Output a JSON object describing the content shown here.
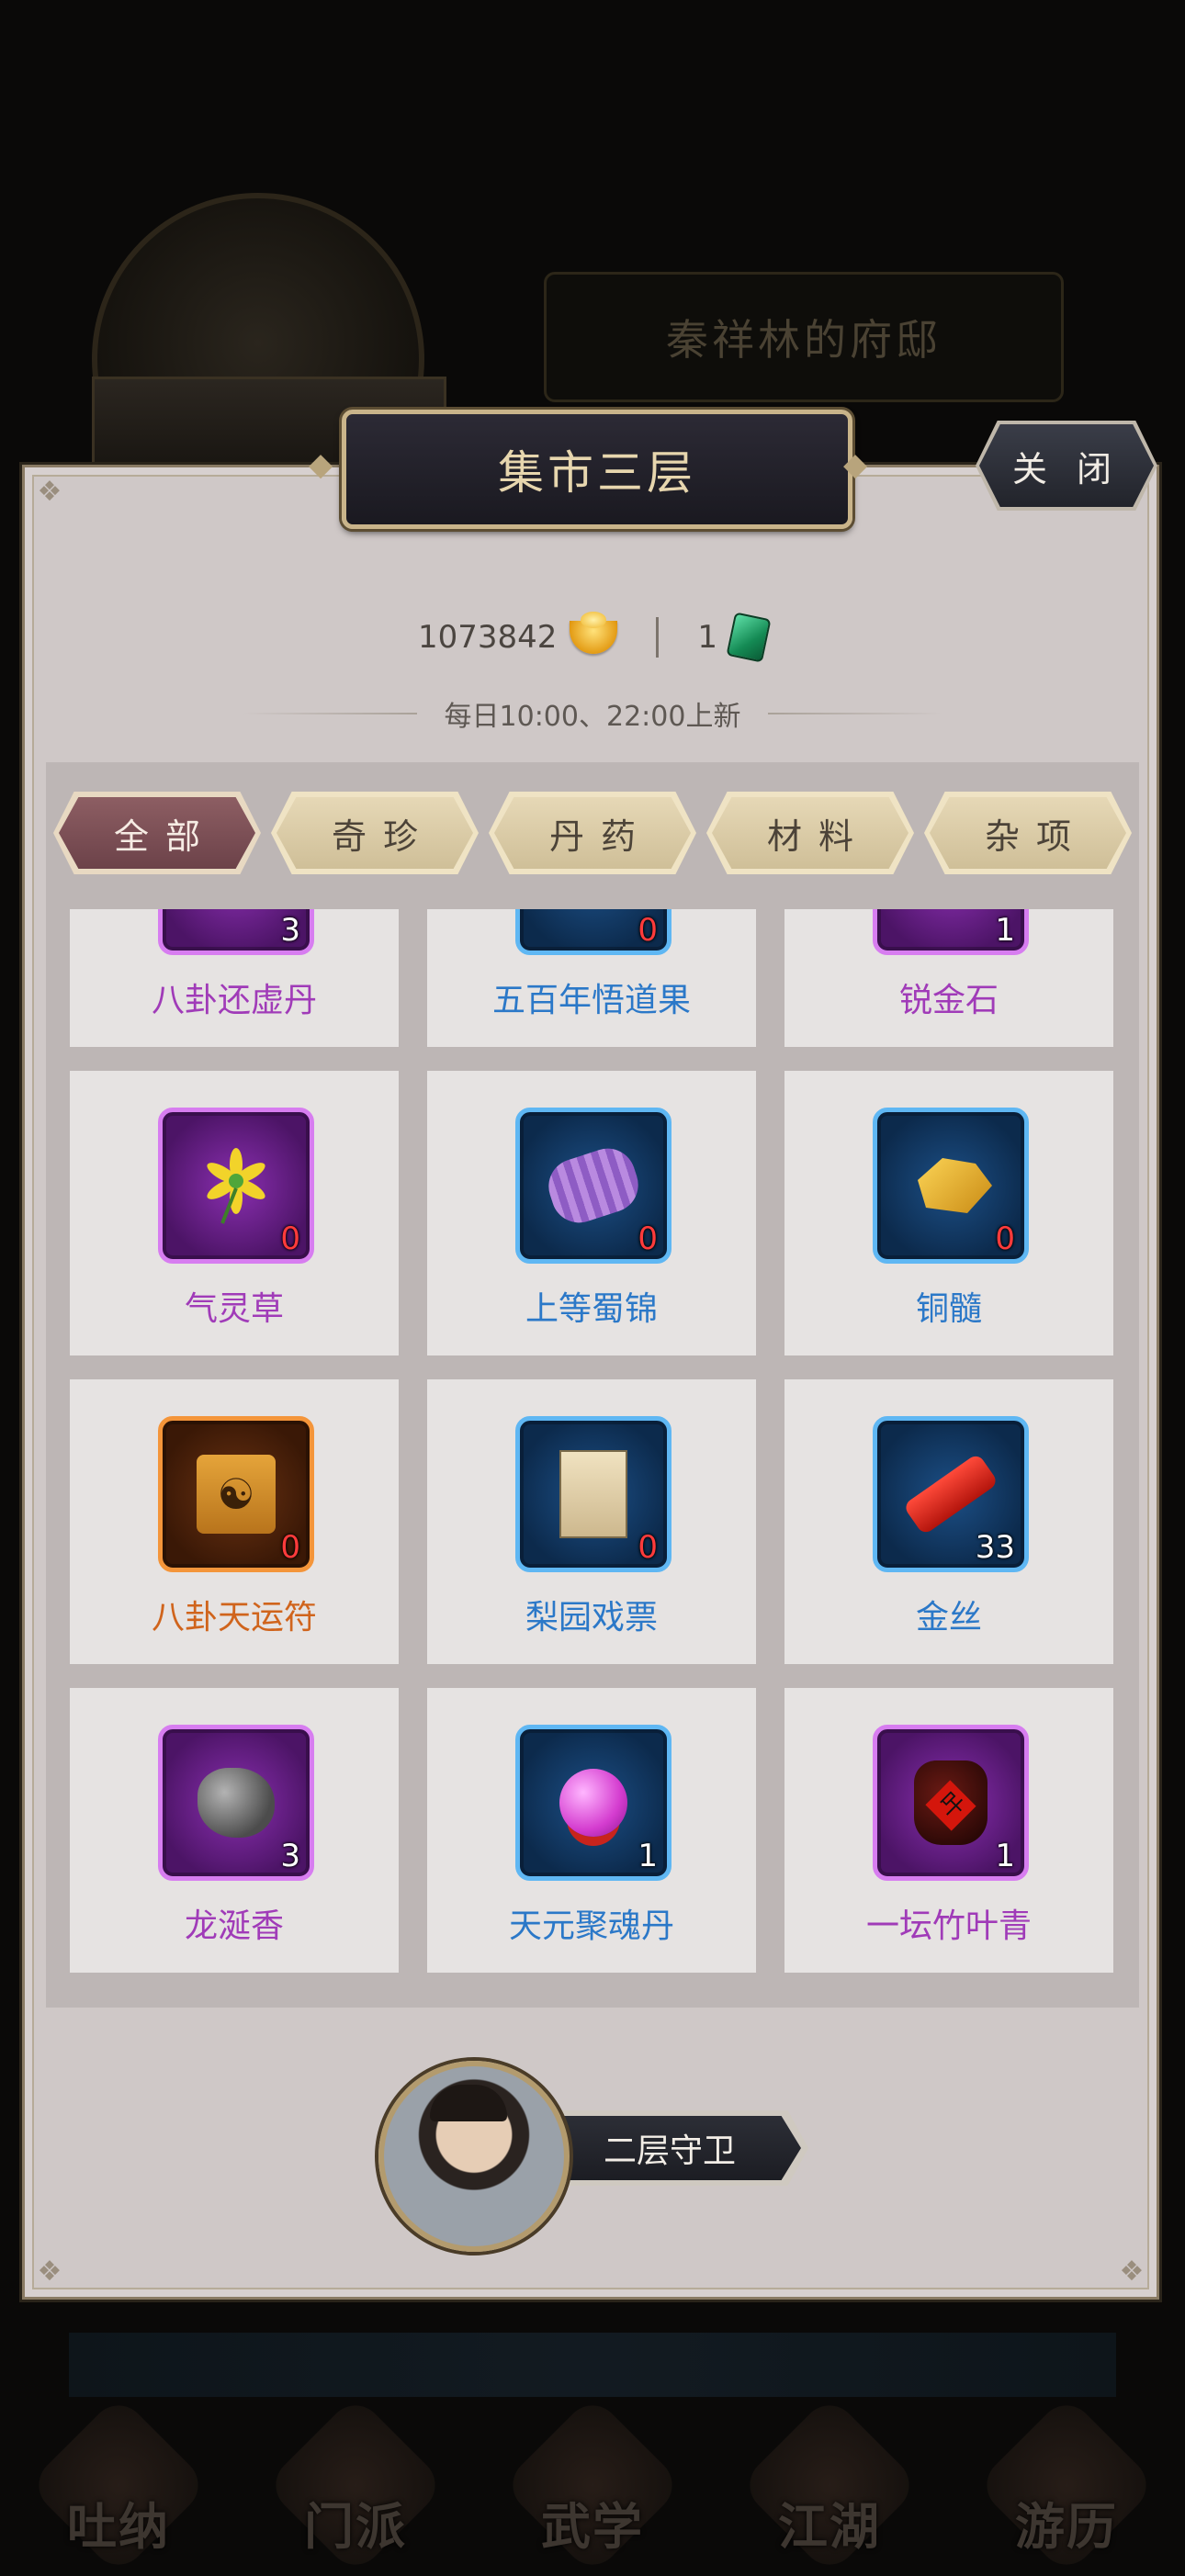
{
  "background": {
    "mansion_label": "秦祥林的府邸",
    "bottom_nav": [
      "吐纳",
      "门派",
      "武学",
      "江湖",
      "游历"
    ]
  },
  "modal": {
    "title": "集市三层",
    "close_label": "关 闭",
    "currency": {
      "gold": "1073842",
      "jade": "1",
      "gold_icon": "gold-ingot-icon",
      "jade_icon": "jade-token-icon"
    },
    "refresh_note": "每日10:00、22:00上新",
    "tabs": [
      {
        "label": "全部",
        "active": true
      },
      {
        "label": "奇珍",
        "active": false
      },
      {
        "label": "丹药",
        "active": false
      },
      {
        "label": "材料",
        "active": false
      },
      {
        "label": "杂项",
        "active": false
      }
    ],
    "items": [
      {
        "name": "八卦还虚丹",
        "count": "3",
        "rarity": "purple",
        "icon": "pill-icon"
      },
      {
        "name": "五百年悟道果",
        "count": "0",
        "rarity": "blue",
        "icon": "fruit-icon"
      },
      {
        "name": "锐金石",
        "count": "1",
        "rarity": "purple",
        "icon": "gold-ore-icon"
      },
      {
        "name": "气灵草",
        "count": "0",
        "rarity": "purple",
        "icon": "herb-icon"
      },
      {
        "name": "上等蜀锦",
        "count": "0",
        "rarity": "blue",
        "icon": "silk-roll-icon"
      },
      {
        "name": "铜髓",
        "count": "0",
        "rarity": "blue",
        "icon": "copper-ore-icon"
      },
      {
        "name": "八卦天运符",
        "count": "0",
        "rarity": "orange",
        "icon": "bagua-charm-icon"
      },
      {
        "name": "梨园戏票",
        "count": "0",
        "rarity": "blue",
        "icon": "ticket-icon"
      },
      {
        "name": "金丝",
        "count": "33",
        "rarity": "blue",
        "icon": "gold-thread-icon"
      },
      {
        "name": "龙涎香",
        "count": "3",
        "rarity": "purple",
        "icon": "ambergris-icon"
      },
      {
        "name": "天元聚魂丹",
        "count": "1",
        "rarity": "blue",
        "icon": "soul-orb-icon"
      },
      {
        "name": "一坛竹叶青",
        "count": "1",
        "rarity": "purple",
        "icon": "wine-jar-icon"
      }
    ],
    "guard_label": "二层守卫",
    "colors": {
      "purple": "#a03bb8",
      "blue": "#2b78c8",
      "orange": "#d0641c",
      "zero_count": "#ff3b3b"
    }
  }
}
